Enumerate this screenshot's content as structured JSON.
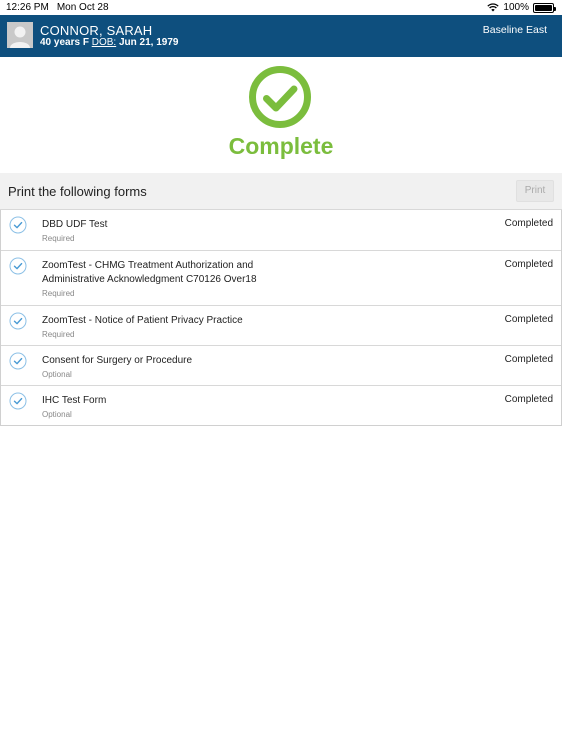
{
  "status_bar": {
    "time": "12:26 PM",
    "date": "Mon Oct 28",
    "battery": "100%",
    "battery_level": 1.0
  },
  "patient": {
    "name": "CONNOR, SARAH",
    "age_sex": "40 years F",
    "dob_label": "DOB:",
    "dob_value": "Jun 21, 1979",
    "location": "Baseline East"
  },
  "complete": {
    "title": "Complete",
    "color": "#7bbd3d"
  },
  "forms_section": {
    "title": "Print the following forms",
    "print_label": "Print"
  },
  "forms": [
    {
      "name": "DBD UDF Test",
      "type": "Required",
      "status": "Completed"
    },
    {
      "name": "ZoomTest - CHMG Treatment Authorization and Administrative Acknowledgment C70126 Over18",
      "type": "Required",
      "status": "Completed"
    },
    {
      "name": "ZoomTest - Notice of Patient Privacy Practice",
      "type": "Required",
      "status": "Completed"
    },
    {
      "name": "Consent for Surgery or Procedure",
      "type": "Optional",
      "status": "Completed"
    },
    {
      "name": "IHC Test Form",
      "type": "Optional",
      "status": "Completed"
    }
  ],
  "colors": {
    "header_bg": "#0e4f7e",
    "check_blue": "#4a9bd4"
  }
}
